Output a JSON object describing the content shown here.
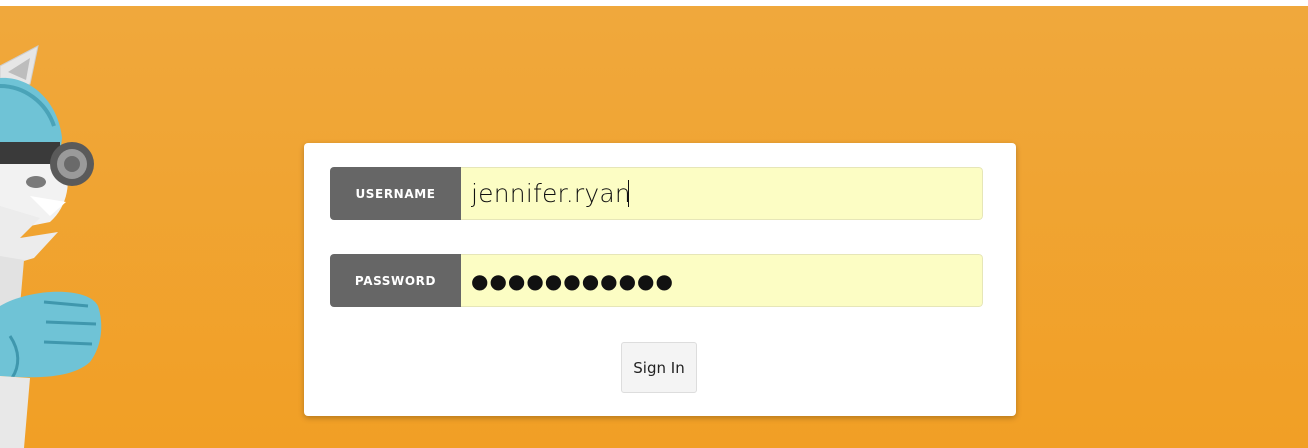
{
  "login": {
    "username_label": "USERNAME",
    "username_value": "jennifer.ryan",
    "password_label": "PASSWORD",
    "password_value": "●●●●●●●●●●●",
    "signin_label": "Sign In"
  },
  "mascot": {
    "icon": "cat-mascot-with-goggles-icon"
  },
  "colors": {
    "background": "#f0a32d",
    "label_bg": "#666666",
    "input_bg": "#fcfdc4",
    "card_bg": "#ffffff"
  }
}
